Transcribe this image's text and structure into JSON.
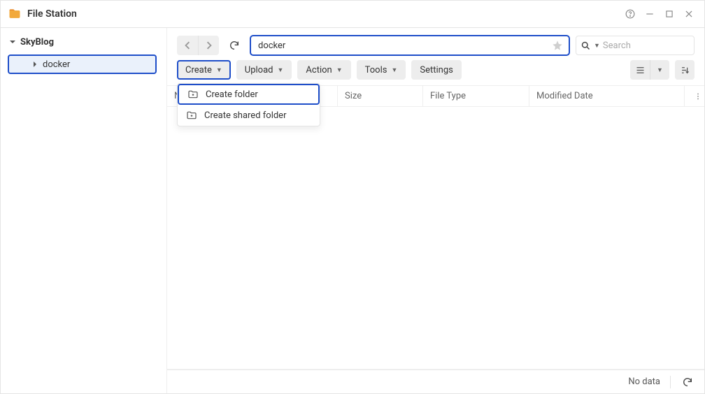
{
  "title": "File Station",
  "sidebar": {
    "root": "SkyBlog",
    "children": [
      "docker"
    ]
  },
  "path": {
    "value": "docker"
  },
  "search": {
    "placeholder": "Search"
  },
  "toolbar": {
    "create": "Create",
    "upload": "Upload",
    "action": "Action",
    "tools": "Tools",
    "settings": "Settings"
  },
  "create_menu": {
    "items": [
      {
        "label": "Create folder"
      },
      {
        "label": "Create shared folder"
      }
    ]
  },
  "columns": {
    "name": "Name",
    "size": "Size",
    "type": "File Type",
    "modified": "Modified Date"
  },
  "status": {
    "nodata": "No data"
  }
}
